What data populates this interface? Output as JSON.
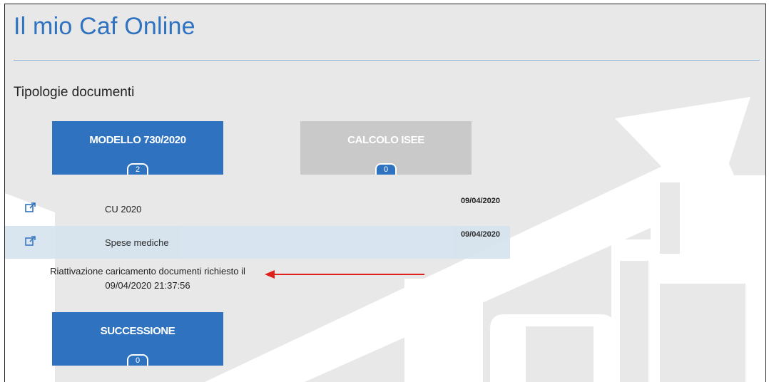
{
  "app": {
    "title": "Il mio Caf Online"
  },
  "section": {
    "title": "Tipologie documenti"
  },
  "tiles": [
    {
      "label": "MODELLO 730/2020",
      "count": "2",
      "state": "active"
    },
    {
      "label": "CALCOLO ISEE",
      "count": "0",
      "state": "disabled"
    },
    {
      "label": "SUCCESSIONE",
      "count": "0",
      "state": "active"
    }
  ],
  "documents": [
    {
      "name": "CU 2020",
      "date": "09/04/2020",
      "icon": "external-link-icon"
    },
    {
      "name": "Spese mediche",
      "date": "09/04/2020",
      "icon": "external-link-icon"
    }
  ],
  "reactivation": {
    "line1": "Riattivazione caricamento documenti richiesto il",
    "line2": "09/04/2020 21:37:56"
  },
  "colors": {
    "accent": "#2f73c0",
    "disabled_tile": "#c9c9c9",
    "background": "#e8e8e8",
    "row_highlight": "#d7e4ef",
    "annotation_arrow": "#e0201b"
  }
}
